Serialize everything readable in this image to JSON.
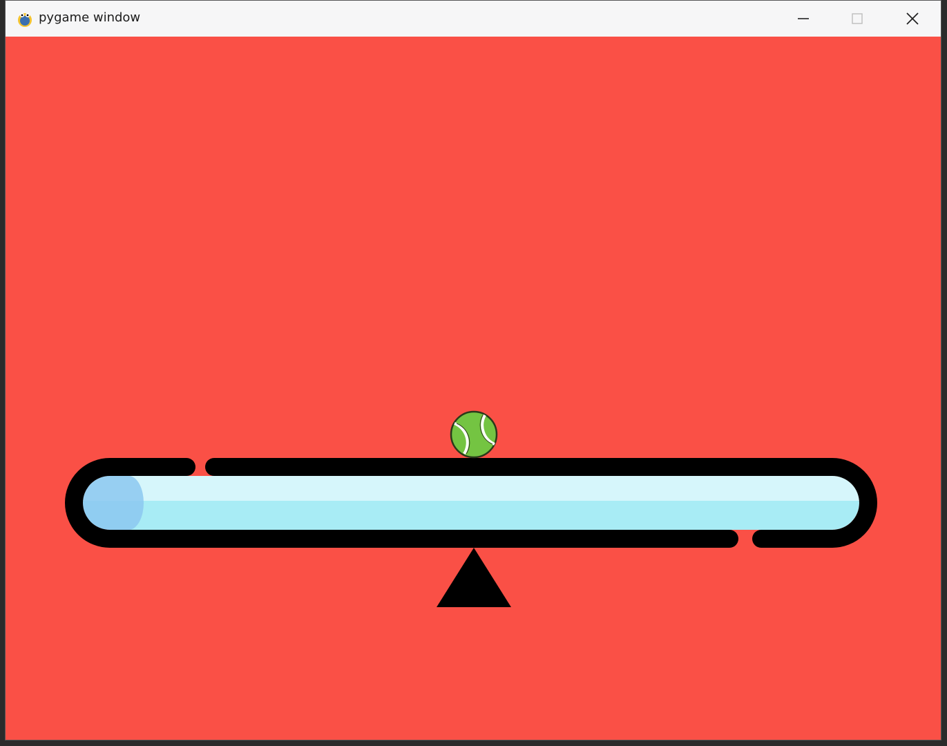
{
  "window": {
    "title": "pygame window",
    "icon": "pygame-snake-icon",
    "controls": {
      "minimize": "minimize-icon",
      "maximize": "maximize-icon",
      "close": "close-icon"
    }
  },
  "game": {
    "background_color": "#fa5046",
    "ball": {
      "icon": "tennis-ball",
      "color": "#74c442"
    },
    "tube": {
      "outline_color": "#000000",
      "liquid_color": "#a8ecf5",
      "highlight_color": "#d6f6fb",
      "bubble_color": "#8cc8f0"
    },
    "pivot": {
      "icon": "triangle-fulcrum",
      "color": "#000000"
    }
  }
}
